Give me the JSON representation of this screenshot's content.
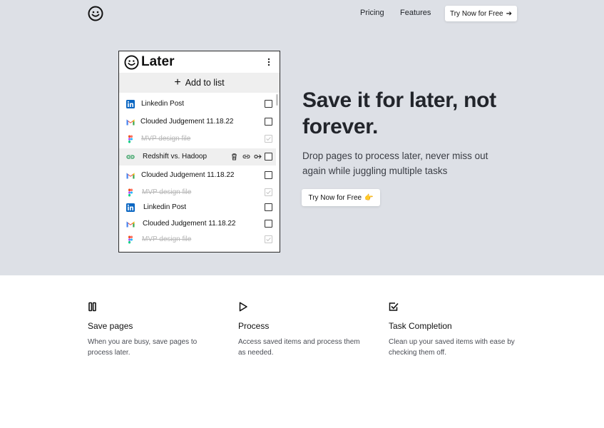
{
  "nav": {
    "pricing": "Pricing",
    "features": "Features",
    "cta": "Try Now for Free",
    "cta_arrow": "➔"
  },
  "panel": {
    "title": "Later",
    "add_label": "Add to list",
    "add_glyph": "+",
    "items": [
      {
        "icon": "linkedin-icon",
        "label": "Linkedin Post",
        "done": false
      },
      {
        "icon": "gmail-icon",
        "label": "Clouded Judgement 11.18.22",
        "done": false
      },
      {
        "icon": "figma-icon",
        "label": "MVP design file",
        "done": true
      },
      {
        "icon": "link-icon",
        "label": "Redshift vs. Hadoop",
        "done": false
      },
      {
        "icon": "gmail-icon",
        "label": "Clouded Judgement 11.18.22",
        "done": false
      },
      {
        "icon": "figma-icon",
        "label": "MVP design file",
        "done": true
      },
      {
        "icon": "linkedin-icon",
        "label": "Linkedin Post",
        "done": false
      },
      {
        "icon": "gmail-icon",
        "label": "Clouded Judgement 11.18.22",
        "done": false
      },
      {
        "icon": "figma-icon",
        "label": "MVP design file",
        "done": true
      }
    ]
  },
  "hero": {
    "headline_line1": "Save it for later, not",
    "headline_line2": "forever.",
    "subtext_line1": "Drop pages to process later, never miss out",
    "subtext_line2": "again while juggling multiple tasks",
    "cta": "Try Now for Free",
    "cta_emoji": "👉"
  },
  "features": [
    {
      "icon": "pause-icon",
      "title": "Save pages",
      "line1": "When you are busy, save pages to",
      "line2": "process later."
    },
    {
      "icon": "play-icon",
      "title": "Process",
      "line1": "Access saved items and process them",
      "line2": "as needed."
    },
    {
      "icon": "checkbox-icon",
      "title": "Task Completion",
      "line1": "Clean up your saved items with ease by",
      "line2": "checking them off."
    }
  ],
  "colors": {
    "hero_bg": "#dde0e6",
    "linkedin": "#0a66c2",
    "gmail_red": "#ea4335",
    "text_dark": "#22252b"
  }
}
